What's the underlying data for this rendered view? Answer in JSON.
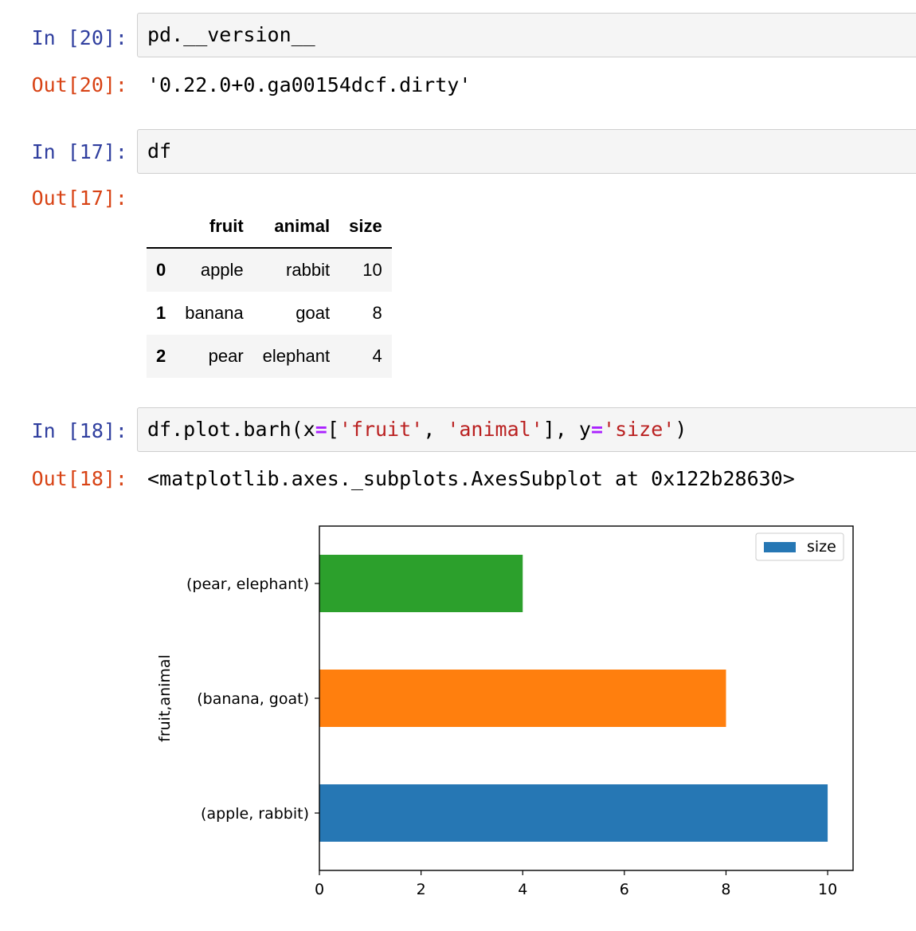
{
  "cells": [
    {
      "in_prompt": "In [20]:",
      "code": "pd.__version__",
      "out_prompt": "Out[20]:",
      "output": "'0.22.0+0.ga00154dcf.dirty'"
    },
    {
      "in_prompt": "In [17]:",
      "code": "df",
      "out_prompt": "Out[17]:"
    },
    {
      "in_prompt": "In [18]:",
      "code_tokens": [
        "df.plot.barh(x",
        "=",
        "[",
        "'fruit'",
        ", ",
        "'animal'",
        "], y",
        "=",
        "'size'",
        ")"
      ],
      "out_prompt": "Out[18]:",
      "output": "<matplotlib.axes._subplots.AxesSubplot at 0x122b28630>"
    }
  ],
  "dataframe": {
    "columns": [
      "",
      "fruit",
      "animal",
      "size"
    ],
    "rows": [
      [
        "0",
        "apple",
        "rabbit",
        "10"
      ],
      [
        "1",
        "banana",
        "goat",
        "8"
      ],
      [
        "2",
        "pear",
        "elephant",
        "4"
      ]
    ]
  },
  "chart_data": {
    "type": "bar",
    "orientation": "horizontal",
    "categories": [
      "(apple, rabbit)",
      "(banana, goat)",
      "(pear, elephant)"
    ],
    "values": [
      10,
      8,
      4
    ],
    "bar_colors": [
      "#2677b4",
      "#ff7f0e",
      "#2ca02c"
    ],
    "series": [
      {
        "name": "size",
        "values": [
          10,
          8,
          4
        ]
      }
    ],
    "title": "",
    "xlabel": "",
    "ylabel": "fruit,animal",
    "xlim": [
      0,
      10.5
    ],
    "xticks": [
      0,
      2,
      4,
      6,
      8,
      10
    ],
    "legend": {
      "position": "top-right",
      "label": "size",
      "color": "#2677b4"
    },
    "grid": false
  }
}
